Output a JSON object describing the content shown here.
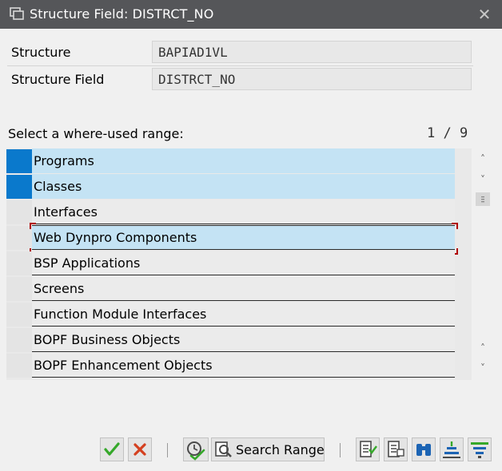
{
  "window": {
    "title": "Structure Field: DISTRCT_NO"
  },
  "fields": [
    {
      "label": "Structure",
      "value": "BAPIAD1VL"
    },
    {
      "label": "Structure Field",
      "value": "DISTRCT_NO"
    }
  ],
  "range": {
    "label": "Select a where-used range:",
    "page": "1 / 9",
    "items": [
      {
        "label": "Programs",
        "selected": true
      },
      {
        "label": "Classes",
        "selected": true
      },
      {
        "label": "Interfaces",
        "selected": false
      },
      {
        "label": "Web Dynpro Components",
        "selected": false,
        "focused": true
      },
      {
        "label": "BSP Applications",
        "selected": false
      },
      {
        "label": "Screens",
        "selected": false
      },
      {
        "label": "Function Module Interfaces",
        "selected": false
      },
      {
        "label": "BOPF Business Objects",
        "selected": false
      },
      {
        "label": "BOPF Enhancement Objects",
        "selected": false
      }
    ]
  },
  "toolbar": {
    "search_range_label": "Search Range",
    "icons": [
      "continue-checkmark-icon",
      "cancel-x-icon",
      "search-clock-icon",
      "search-range-icon",
      "select-all-icon",
      "deselect-all-icon",
      "find-binoculars-icon",
      "details-icon",
      "filter-icon"
    ]
  },
  "colors": {
    "titlebar": "#555659",
    "selection": "#0a79cc",
    "row_highlight": "#c4e3f4",
    "focus_marker": "#b00000"
  }
}
